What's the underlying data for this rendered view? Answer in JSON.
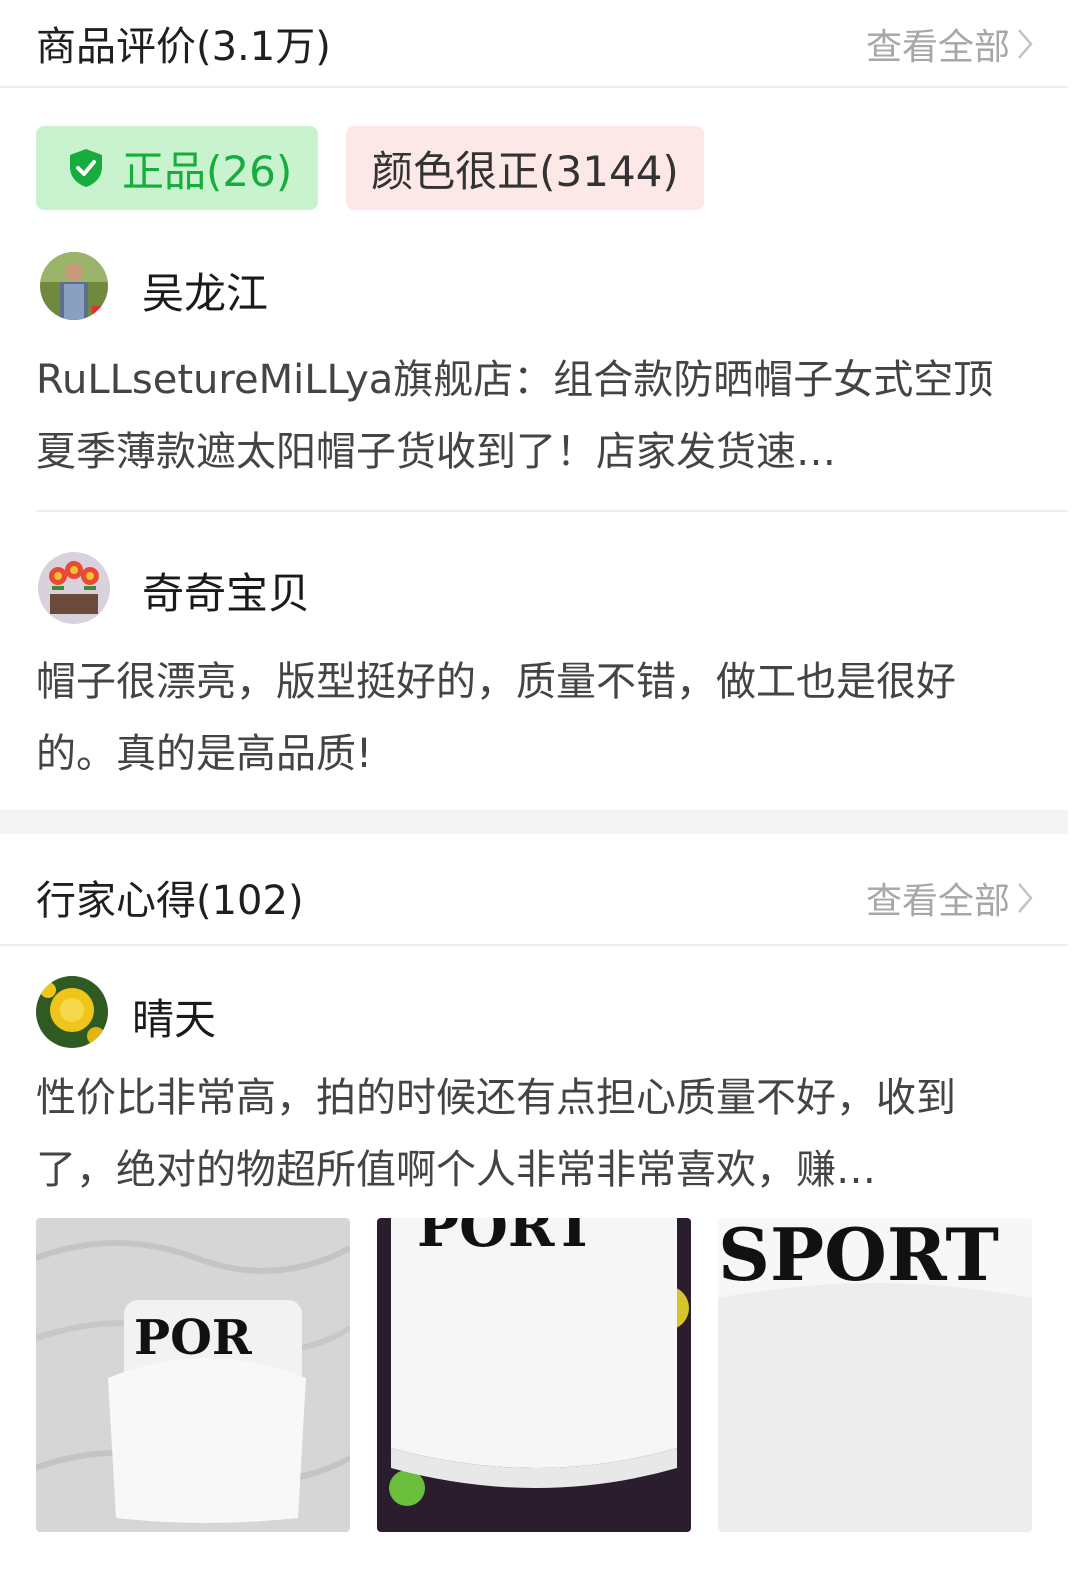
{
  "reviews_section": {
    "title": "商品评价(3.1万)",
    "view_all": "查看全部",
    "tags": [
      {
        "label": "正品(26)",
        "icon": "shield-check-icon",
        "color": "#16ad3e"
      },
      {
        "label": "颜色很正(3144)"
      }
    ],
    "items": [
      {
        "user": "吴龙江",
        "text": "RuLLsetureMiLLya旗舰店：组合款防晒帽子女式空顶夏季薄款遮太阳帽子货收到了！店家发货速…"
      },
      {
        "user": "奇奇宝贝",
        "text": "帽子很漂亮，版型挺好的，质量不错，做工也是很好的。真的是高品质!"
      }
    ]
  },
  "experience_section": {
    "title": "行家心得(102)",
    "view_all": "查看全部",
    "item": {
      "user": "晴天",
      "text": "性价比非常高，拍的时候还有点担心质量不好，收到了，绝对的物超所值啊个人非常非常喜欢，赚…",
      "photos": [
        {
          "caption": "POR"
        },
        {
          "caption": "PORT"
        },
        {
          "caption": "SPORT"
        }
      ]
    }
  },
  "colors": {
    "accent_green": "#16ad3e",
    "tag_green_bg": "#c9f3cf",
    "tag_pink_bg": "#fde8e8",
    "muted_text": "#a7a7a7"
  }
}
